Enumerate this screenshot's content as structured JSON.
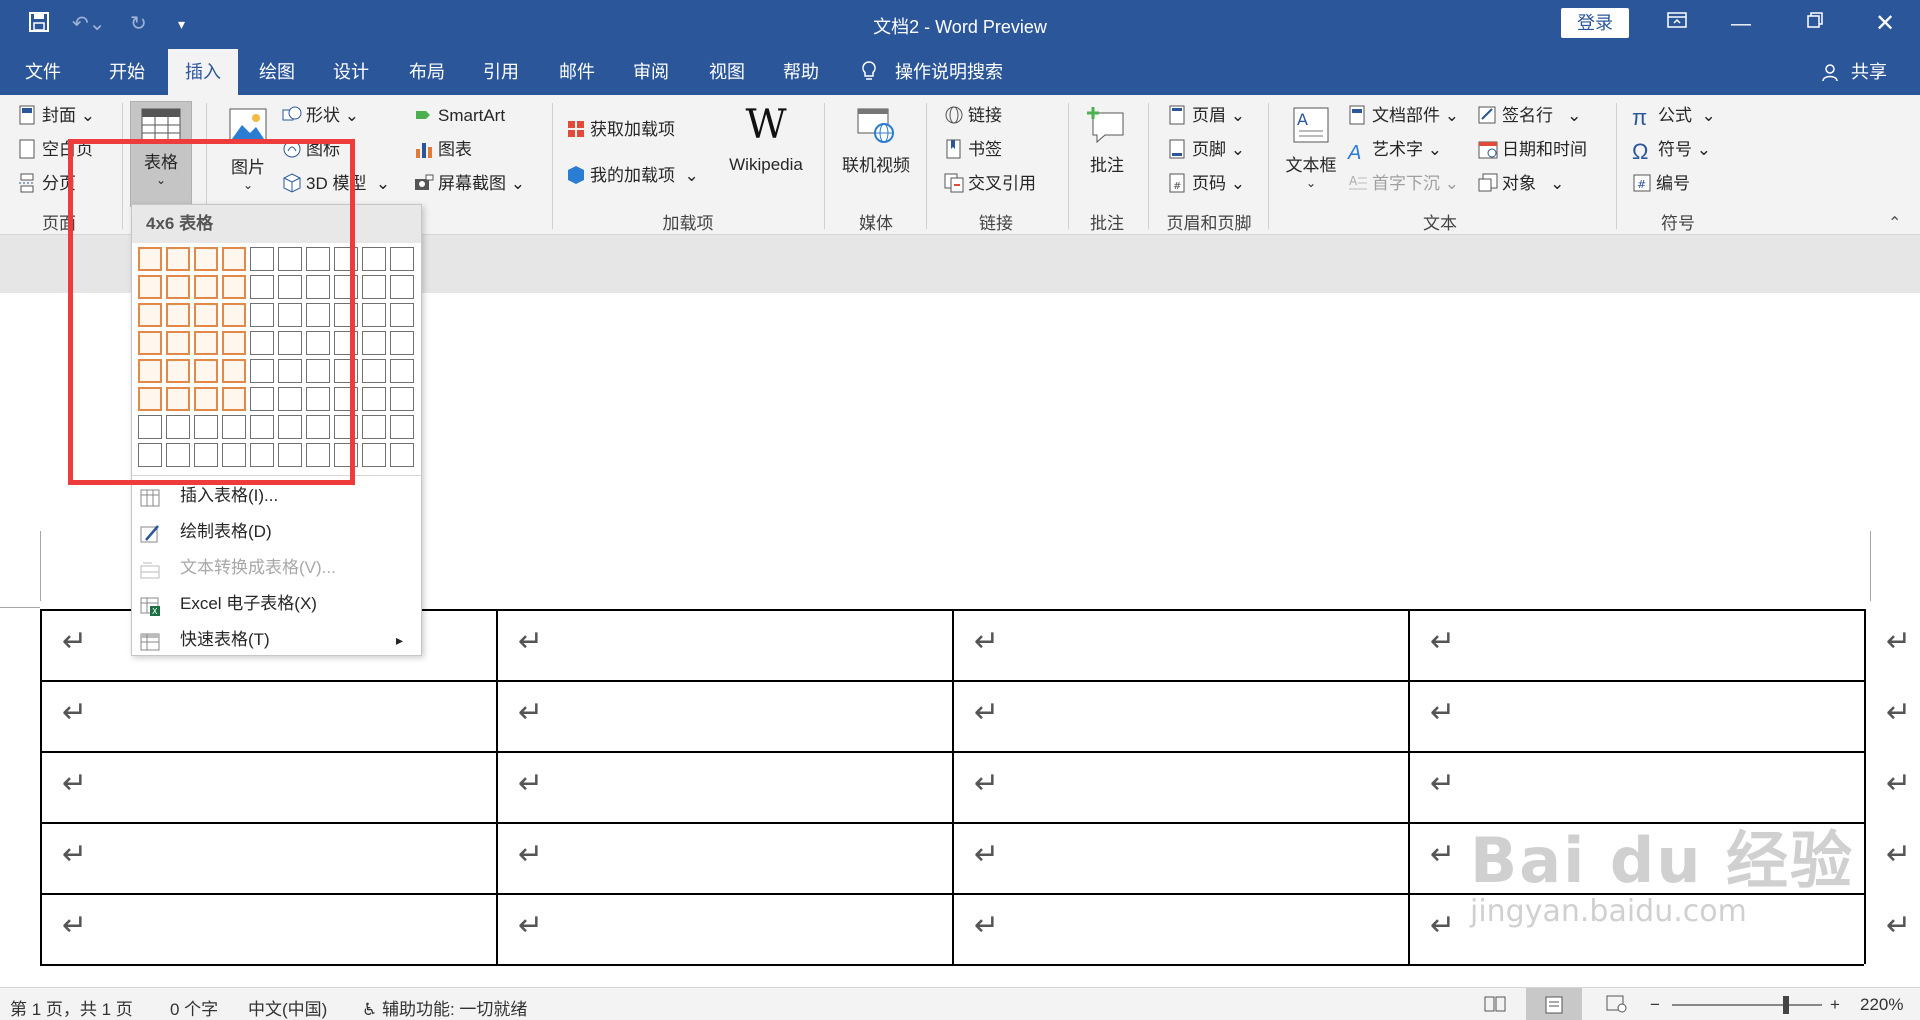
{
  "window": {
    "title": "文档2  -  Word Preview",
    "login": "登录",
    "qat": {
      "save_icon": "save-icon",
      "undo_icon": "undo-icon",
      "redo_icon": "redo-icon",
      "customize_icon": "customize-icon"
    }
  },
  "tabs": [
    "文件",
    "开始",
    "插入",
    "绘图",
    "设计",
    "布局",
    "引用",
    "邮件",
    "审阅",
    "视图",
    "帮助"
  ],
  "active_tab": "插入",
  "search": "操作说明搜索",
  "share": "共享",
  "ribbon": {
    "pages": {
      "cover": "封面",
      "blank": "空白页",
      "break": "分页",
      "label": "页面"
    },
    "table": {
      "label": "表格"
    },
    "illustrations": {
      "picture": "图片",
      "shapes": "形状",
      "icons": "图标",
      "model3d": "3D 模型",
      "smartart": "SmartArt",
      "chart": "图表",
      "screenshot": "屏幕截图"
    },
    "addins": {
      "get": "获取加载项",
      "mine": "我的加载项",
      "wiki": "Wikipedia",
      "label": "加载项"
    },
    "media": {
      "video": "联机视频",
      "label": "媒体"
    },
    "links": {
      "link": "链接",
      "bookmark": "书签",
      "xref": "交叉引用",
      "label": "链接"
    },
    "comments": {
      "comment": "批注",
      "label": "批注"
    },
    "header_footer": {
      "header": "页眉",
      "footer": "页脚",
      "page_number": "页码",
      "label": "页眉和页脚"
    },
    "text": {
      "textbox": "文本框",
      "quickparts": "文档部件",
      "wordart": "艺术字",
      "dropcap": "首字下沉",
      "signature": "签名行",
      "datetime": "日期和时间",
      "object": "对象",
      "label": "文本"
    },
    "symbols": {
      "equation": "公式",
      "symbol": "符号",
      "number": "编号",
      "label": "符号"
    }
  },
  "table_menu": {
    "header": "4x6 表格",
    "grid_cols": 10,
    "grid_rows": 8,
    "selected_cols": 4,
    "selected_rows": 6,
    "items": [
      {
        "label": "插入表格(I)...",
        "enabled": true
      },
      {
        "label": "绘制表格(D)",
        "enabled": true
      },
      {
        "label": "文本转换成表格(V)...",
        "enabled": false
      },
      {
        "label": "Excel 电子表格(X)",
        "enabled": true
      },
      {
        "label": "快速表格(T)",
        "enabled": true,
        "submenu_arrow": "▸"
      }
    ]
  },
  "document": {
    "return_mark": "↵",
    "rows": 5,
    "cols": 4
  },
  "status": {
    "page": "第 1 页，共 1 页",
    "words": "0 个字",
    "lang": "中文(中国)",
    "accessibility": "辅助功能: 一切就绪",
    "zoom": "220%",
    "zoom_level": 0.76
  },
  "watermark": {
    "logo": "Bai du 经验",
    "url": "jingyan.baidu.com"
  }
}
